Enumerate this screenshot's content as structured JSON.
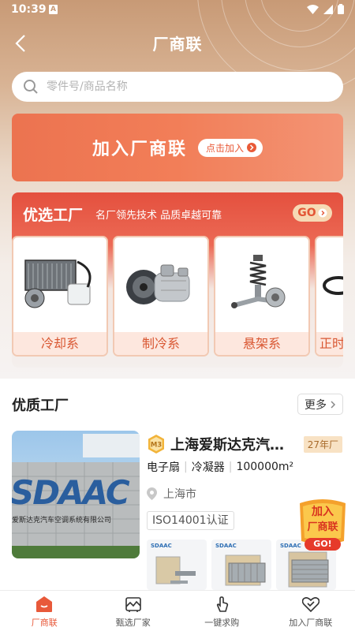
{
  "status_bar": {
    "time": "10:39",
    "notification_letter": "A"
  },
  "header": {
    "title": "厂商联"
  },
  "search": {
    "placeholder": "零件号/商品名称"
  },
  "join_banner": {
    "text": "加入厂商联",
    "button_label": "点击加入"
  },
  "featured": {
    "title": "优选工厂",
    "subtitle": "名厂领先技术 品质卓越可靠",
    "go_label": "GO",
    "categories": [
      {
        "label": "冷却系",
        "icon": "cooling-radiator-icon"
      },
      {
        "label": "制冷系",
        "icon": "ac-compressor-icon"
      },
      {
        "label": "悬架系",
        "icon": "suspension-strut-icon"
      },
      {
        "label": "正时",
        "icon": "timing-belt-icon"
      }
    ]
  },
  "quality": {
    "title": "优质工厂",
    "more_label": "更多",
    "factory": {
      "level_badge": "M3",
      "name": "上海爱斯达克汽…",
      "years": "27年厂",
      "tags": [
        "电子扇",
        "冷凝器",
        "100000m²"
      ],
      "location": "上海市",
      "certification": "ISO14001认证",
      "photo_sign_text": "SDAAC",
      "photo_sign_sub": "爱斯达克汽车空调系统有限公司",
      "thumb_logo": "SDAAC"
    }
  },
  "floating_join": {
    "line1": "加入",
    "line2": "厂商联",
    "line3": "GO!"
  },
  "tabbar": {
    "tabs": [
      {
        "label": "厂商联",
        "active": true
      },
      {
        "label": "甄选厂家",
        "active": false
      },
      {
        "label": "一键求购",
        "active": false
      },
      {
        "label": "加入厂商联",
        "active": false
      }
    ]
  },
  "colors": {
    "accent": "#e8593a",
    "banner_orange": "#ef7652",
    "card_red": "#e4503e"
  }
}
